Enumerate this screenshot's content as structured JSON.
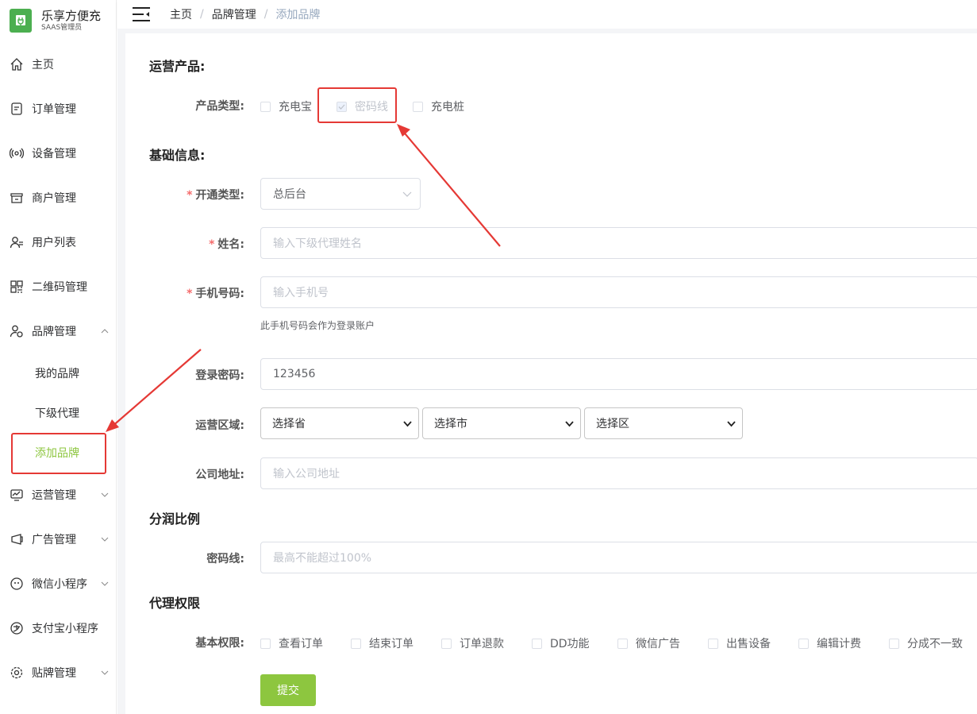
{
  "brand": {
    "name": "乐享方便充",
    "subtitle": "SAAS管理员"
  },
  "sidebar": {
    "items": [
      {
        "label": "主页",
        "icon": "home-icon"
      },
      {
        "label": "订单管理",
        "icon": "order-icon"
      },
      {
        "label": "设备管理",
        "icon": "device-icon"
      },
      {
        "label": "商户管理",
        "icon": "merchant-icon"
      },
      {
        "label": "用户列表",
        "icon": "user-icon"
      },
      {
        "label": "二维码管理",
        "icon": "qrcode-icon"
      },
      {
        "label": "品牌管理",
        "icon": "brand-icon"
      },
      {
        "label": "运营管理",
        "icon": "operation-icon"
      },
      {
        "label": "广告管理",
        "icon": "ad-icon"
      },
      {
        "label": "微信小程序",
        "icon": "wechat-icon"
      },
      {
        "label": "支付宝小程序",
        "icon": "alipay-icon"
      },
      {
        "label": "贴牌管理",
        "icon": "gear-icon"
      }
    ],
    "brand_sub": [
      "我的品牌",
      "下级代理",
      "添加品牌"
    ]
  },
  "breadcrumb": [
    "主页",
    "品牌管理",
    "添加品牌"
  ],
  "form": {
    "section_product": "运营产品:",
    "product_type_label": "产品类型:",
    "product_types": [
      "充电宝",
      "密码线",
      "充电桩"
    ],
    "section_basic": "基础信息:",
    "open_type_label": "开通类型:",
    "open_type_value": "总后台",
    "name_label": "姓名:",
    "name_placeholder": "输入下级代理姓名",
    "phone_label": "手机号码:",
    "phone_placeholder": "输入手机号",
    "phone_hint": "此手机号码会作为登录账户",
    "password_label": "登录密码:",
    "password_value": "123456",
    "region_label": "运营区域:",
    "province": "选择省",
    "city": "选择市",
    "district": "选择区",
    "address_label": "公司地址:",
    "address_placeholder": "输入公司地址",
    "section_share": "分润比例",
    "share_label": "密码线:",
    "share_placeholder": "最高不能超过100%",
    "section_perm": "代理权限",
    "perm_label": "基本权限:",
    "perms": [
      "查看订单",
      "结束订单",
      "订单退款",
      "DD功能",
      "微信广告",
      "出售设备",
      "编辑计费",
      "分成不一致"
    ],
    "submit": "提交"
  },
  "colors": {
    "accent": "#8dc63f",
    "annotation": "#e53935",
    "required": "#f56c6c"
  }
}
